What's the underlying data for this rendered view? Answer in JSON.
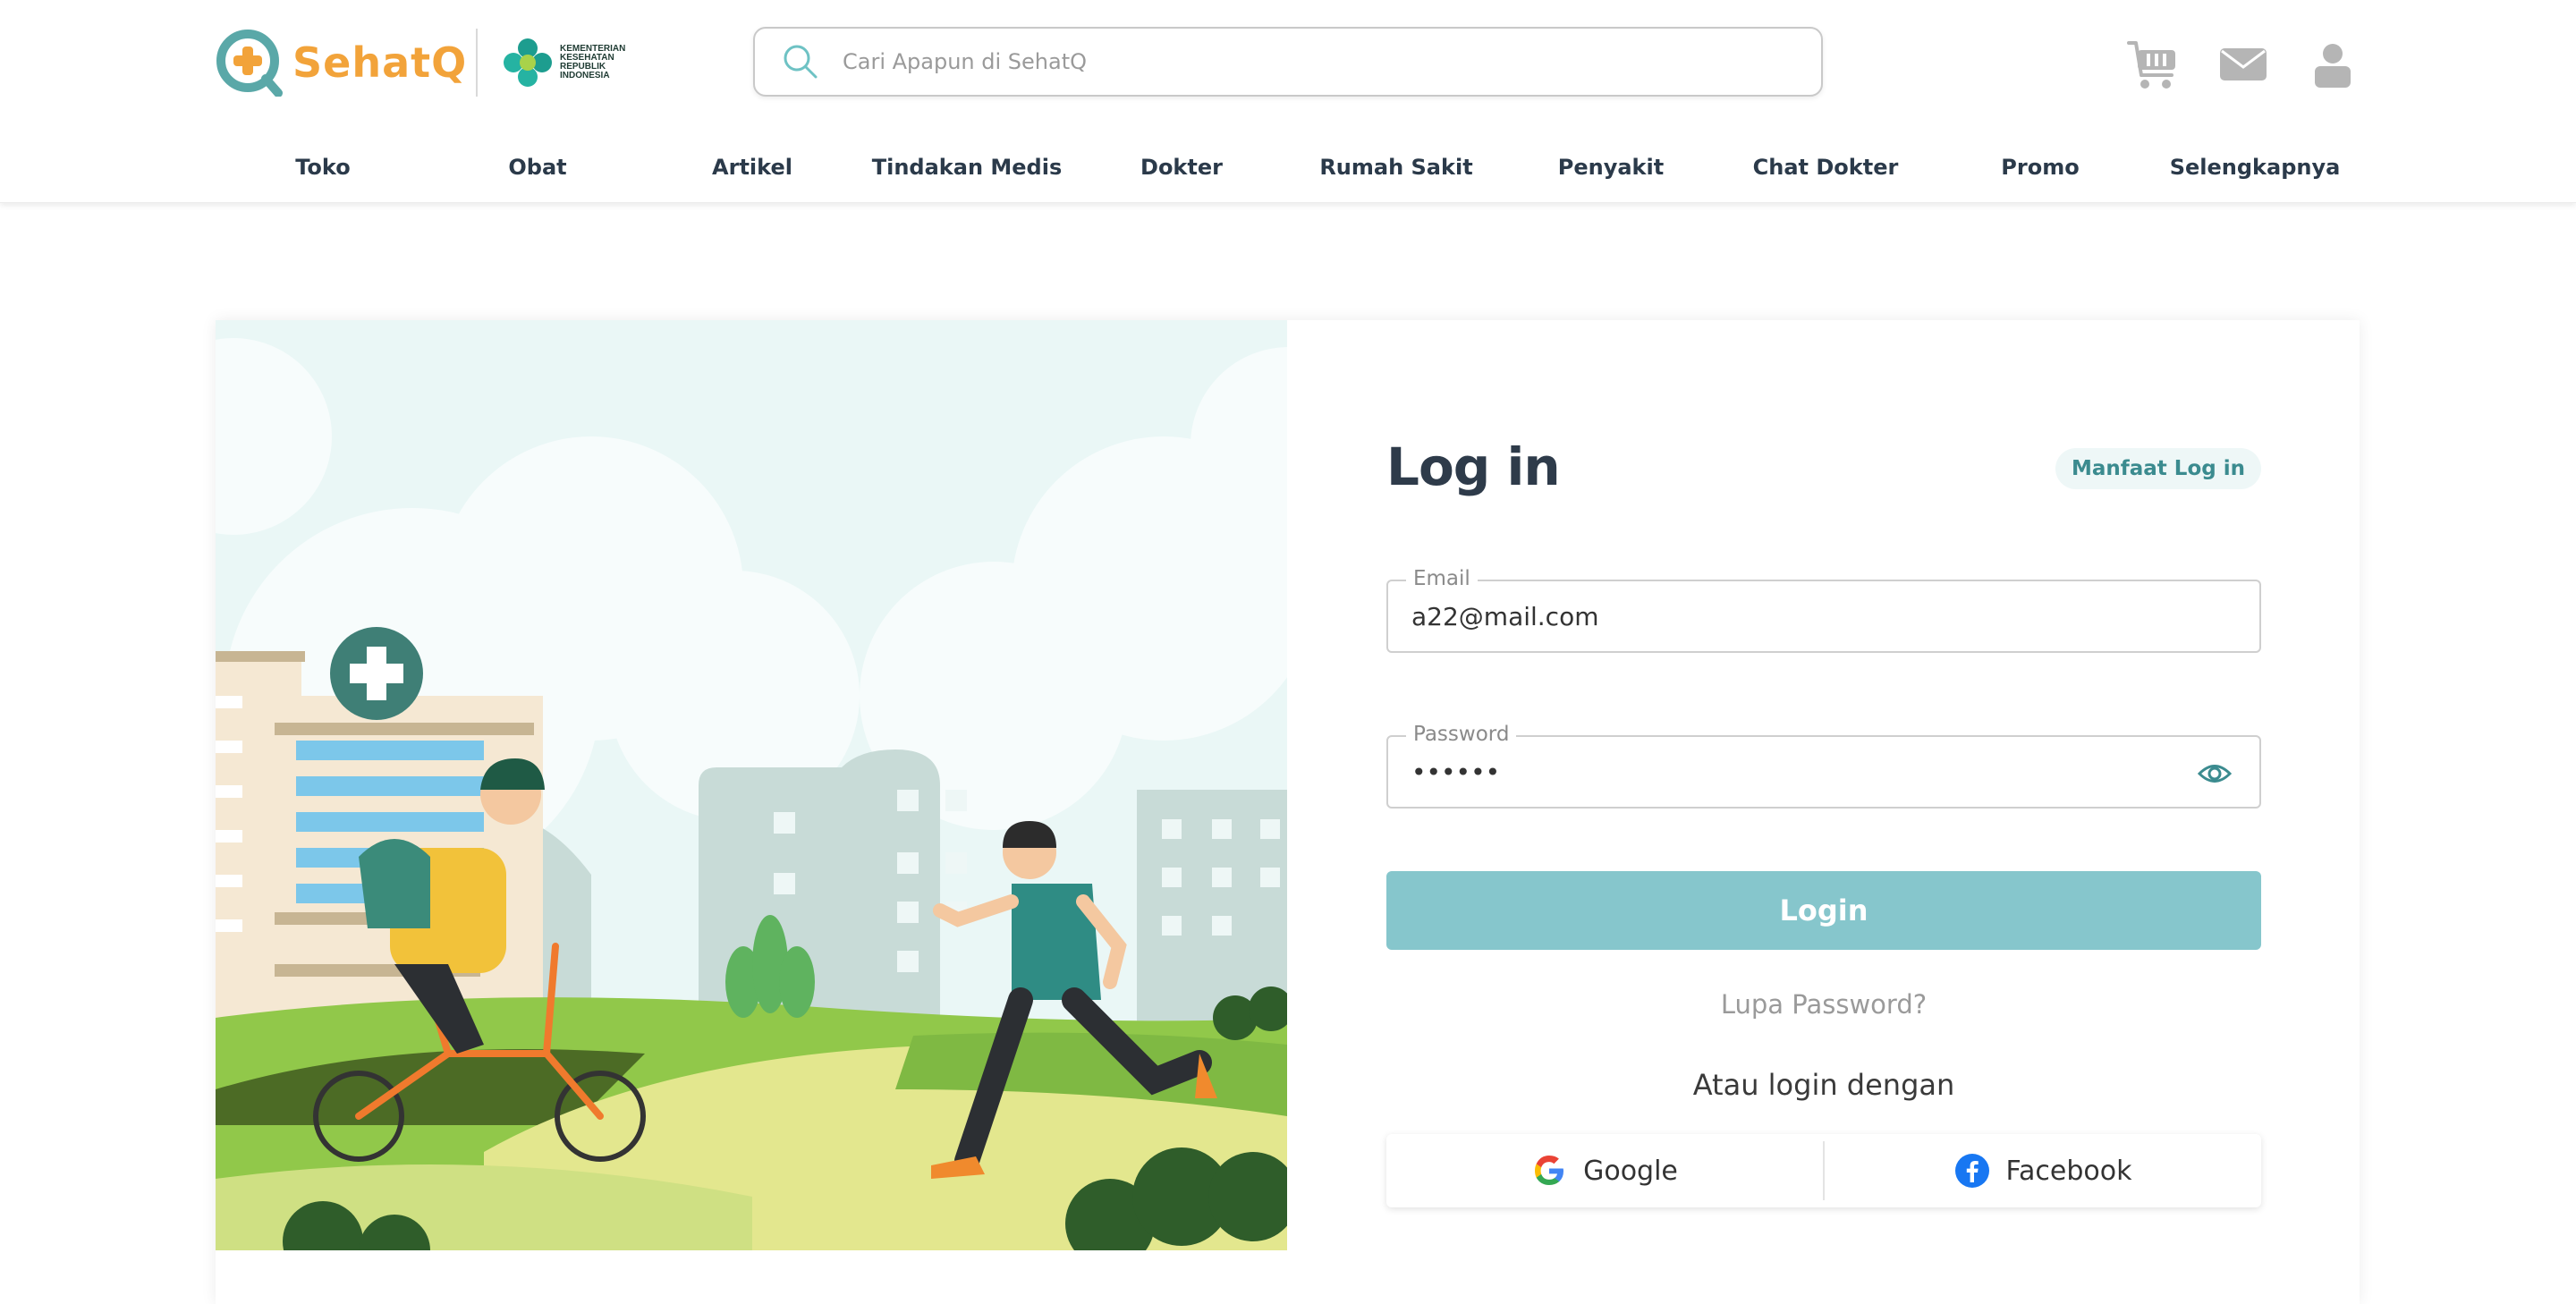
{
  "header": {
    "logo_text": "SehatQ",
    "kemenkes_lines": [
      "KEMENTERIAN",
      "KESEHATAN",
      "REPUBLIK",
      "INDONESIA"
    ],
    "search_placeholder": "Cari Apapun di SehatQ",
    "icons": [
      "cart-icon",
      "mail-icon",
      "user-icon"
    ]
  },
  "nav": {
    "items": [
      "Toko",
      "Obat",
      "Artikel",
      "Tindakan Medis",
      "Dokter",
      "Rumah Sakit",
      "Penyakit",
      "Chat Dokter",
      "Promo",
      "Selengkapnya"
    ]
  },
  "login": {
    "title": "Log in",
    "benefit_link": "Manfaat Log in",
    "email_label": "Email",
    "email_value": "a22@mail.com",
    "password_label": "Password",
    "password_value": "••••••",
    "submit_label": "Login",
    "forgot_label": "Lupa Password?",
    "alt_label": "Atau login dengan",
    "google_label": "Google",
    "facebook_label": "Facebook"
  },
  "colors": {
    "brand_orange": "#f2a33a",
    "brand_teal": "#5aa8a8",
    "login_button": "#86c6cc",
    "benefit_text": "#3b8b8f"
  }
}
